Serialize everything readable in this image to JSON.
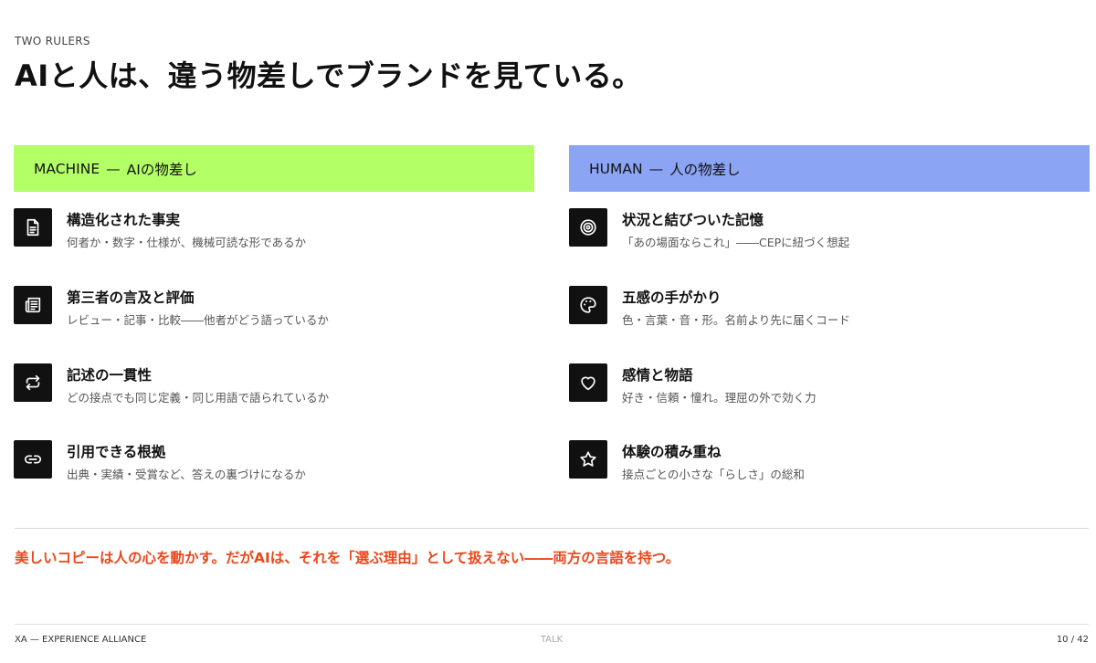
{
  "header": {
    "eyebrow": "TWO RULERS",
    "title": "AIと人は、違う物差しでブランドを見ている。"
  },
  "machine": {
    "label": "MACHINE",
    "dash": "—",
    "sublabel": "AIの物差し",
    "color": "#b3ff66",
    "items": [
      {
        "icon": "document-icon",
        "title": "構造化された事実",
        "desc": "何者か・数字・仕様が、機械可読な形であるか"
      },
      {
        "icon": "newspaper-icon",
        "title": "第三者の言及と評価",
        "desc": "レビュー・記事・比較――他者がどう語っているか"
      },
      {
        "icon": "repeat-icon",
        "title": "記述の一貫性",
        "desc": "どの接点でも同じ定義・同じ用語で語られているか"
      },
      {
        "icon": "link-icon",
        "title": "引用できる根拠",
        "desc": "出典・実績・受賞など、答えの裏づけになるか"
      }
    ]
  },
  "human": {
    "label": "HUMAN",
    "dash": "—",
    "sublabel": "人の物差し",
    "color": "#8ca4f4",
    "items": [
      {
        "icon": "target-icon",
        "title": "状況と結びついた記憶",
        "desc": "「あの場面ならこれ」――CEPに紐づく想起"
      },
      {
        "icon": "palette-icon",
        "title": "五感の手がかり",
        "desc": "色・言葉・音・形。名前より先に届くコード"
      },
      {
        "icon": "heart-icon",
        "title": "感情と物語",
        "desc": "好き・信頼・憧れ。理屈の外で効く力"
      },
      {
        "icon": "star-icon",
        "title": "体験の積み重ね",
        "desc": "接点ごとの小さな「らしさ」の総和"
      }
    ]
  },
  "takeaway": "美しいコピーは人の心を動かす。だがAIは、それを「選ぶ理由」として扱えない――両方の言語を持つ。",
  "accent_color": "#e8481b",
  "footer": {
    "left": "XA — EXPERIENCE ALLIANCE",
    "center": "TALK",
    "right": "10 / 42"
  }
}
